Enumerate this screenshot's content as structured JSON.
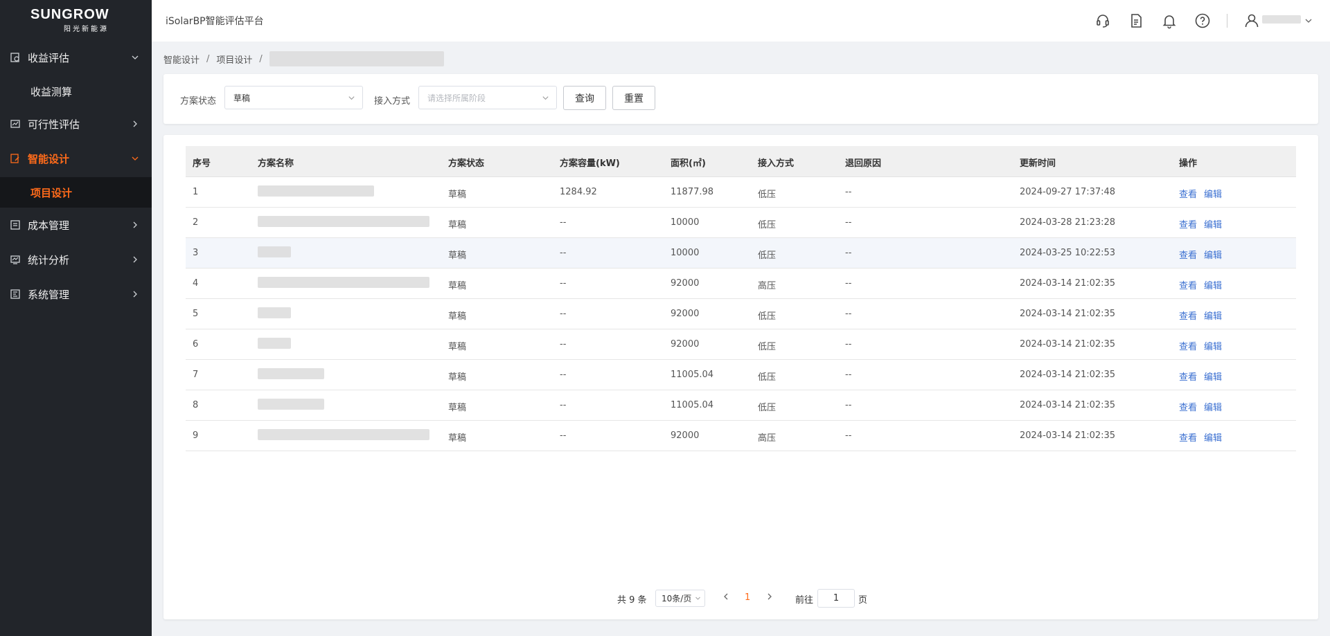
{
  "logo": {
    "brand": "SUNGROW",
    "sub": "阳光新能源"
  },
  "sidebar": {
    "items": [
      {
        "label": "收益评估",
        "icon": "revenue-icon",
        "expanded": true
      },
      {
        "label": "收益测算",
        "sub": true
      },
      {
        "label": "可行性评估",
        "icon": "feasibility-icon"
      },
      {
        "label": "智能设计",
        "icon": "design-icon",
        "expanded": true,
        "active": true
      },
      {
        "label": "项目设计",
        "sub": true,
        "active": true
      },
      {
        "label": "成本管理",
        "icon": "cost-icon"
      },
      {
        "label": "统计分析",
        "icon": "stats-icon"
      },
      {
        "label": "系统管理",
        "icon": "system-icon"
      }
    ]
  },
  "header": {
    "title": "iSolarBP智能评估平台",
    "icons": [
      "headset-icon",
      "document-icon",
      "bell-icon",
      "help-icon",
      "user-icon"
    ]
  },
  "breadcrumb": {
    "items": [
      "智能设计",
      "项目设计"
    ]
  },
  "filters": {
    "status_label": "方案状态",
    "status_value": "草稿",
    "access_label": "接入方式",
    "access_placeholder": "请选择所属阶段",
    "query_button": "查询",
    "reset_button": "重置"
  },
  "table": {
    "headers": [
      "序号",
      "方案名称",
      "方案状态",
      "方案容量(kW)",
      "面积(㎡)",
      "接入方式",
      "退回原因",
      "更新时间",
      "操作"
    ],
    "rows": [
      {
        "no": "1",
        "status": "草稿",
        "capacity": "1284.92",
        "area": "11877.98",
        "access": "低压",
        "reason": "--",
        "time": "2024-09-27 17:37:48"
      },
      {
        "no": "2",
        "status": "草稿",
        "capacity": "--",
        "area": "10000",
        "access": "低压",
        "reason": "--",
        "time": "2024-03-28 21:23:28"
      },
      {
        "no": "3",
        "status": "草稿",
        "capacity": "--",
        "area": "10000",
        "access": "低压",
        "reason": "--",
        "time": "2024-03-25 10:22:53"
      },
      {
        "no": "4",
        "status": "草稿",
        "capacity": "--",
        "area": "92000",
        "access": "高压",
        "reason": "--",
        "time": "2024-03-14 21:02:35"
      },
      {
        "no": "5",
        "status": "草稿",
        "capacity": "--",
        "area": "92000",
        "access": "低压",
        "reason": "--",
        "time": "2024-03-14 21:02:35"
      },
      {
        "no": "6",
        "status": "草稿",
        "capacity": "--",
        "area": "92000",
        "access": "低压",
        "reason": "--",
        "time": "2024-03-14 21:02:35"
      },
      {
        "no": "7",
        "status": "草稿",
        "capacity": "--",
        "area": "11005.04",
        "access": "低压",
        "reason": "--",
        "time": "2024-03-14 21:02:35"
      },
      {
        "no": "8",
        "status": "草稿",
        "capacity": "--",
        "area": "11005.04",
        "access": "低压",
        "reason": "--",
        "time": "2024-03-14 21:02:35"
      },
      {
        "no": "9",
        "status": "草稿",
        "capacity": "--",
        "area": "92000",
        "access": "高压",
        "reason": "--",
        "time": "2024-03-14 21:02:35"
      }
    ],
    "actions": {
      "view": "查看",
      "edit": "编辑"
    }
  },
  "pagination": {
    "total": "共 9 条",
    "page_size": "10条/页",
    "current_page": "1",
    "goto_label": "前往",
    "goto_value": "1",
    "page_suffix": "页"
  },
  "colors": {
    "accent": "#ff6b1a",
    "link": "#3a6fd1",
    "sidebar_bg": "#22252a"
  }
}
